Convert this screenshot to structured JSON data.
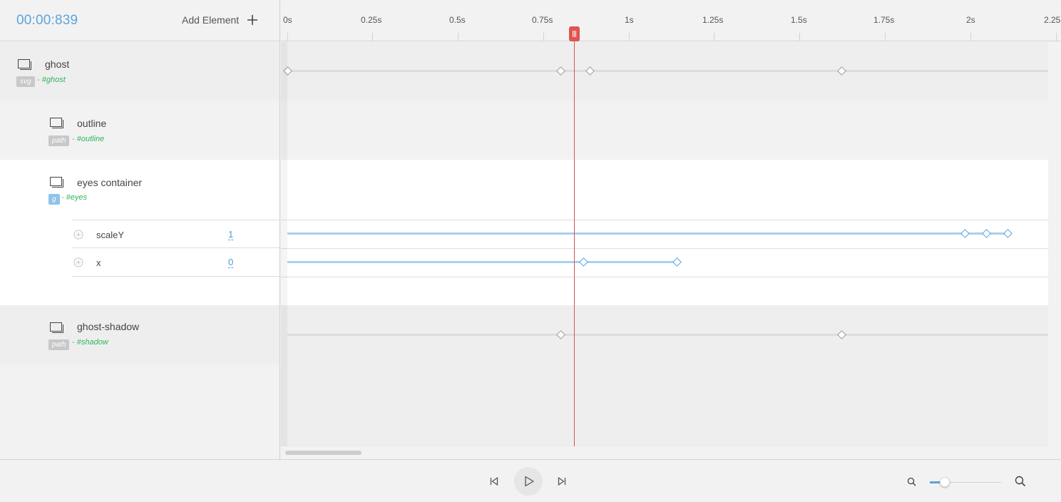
{
  "header": {
    "time": "00:00:839",
    "add_element_label": "Add Element"
  },
  "ruler": {
    "ticks": [
      "0s",
      "0.25s",
      "0.5s",
      "0.75s",
      "1s",
      "1.25s",
      "1.5s",
      "1.75s",
      "2s",
      "2.25"
    ]
  },
  "elements": [
    {
      "name": "ghost",
      "tag": "svg",
      "selector": "#ghost"
    },
    {
      "name": "outline",
      "tag": "path",
      "selector": "#outline"
    },
    {
      "name": "eyes container",
      "tag": "g",
      "selector": "#eyes"
    },
    {
      "name": "ghost-shadow",
      "tag": "path",
      "selector": "#shadow"
    }
  ],
  "properties": [
    {
      "name": "scaleY",
      "value": "1"
    },
    {
      "name": "x",
      "value": "0"
    }
  ],
  "separator": "-",
  "playhead_time_s": 0.839,
  "zoom_level": 0.2,
  "colors": {
    "accent": "#5aa4dc",
    "playhead": "#d9534f",
    "selector": "#2fb55b"
  }
}
